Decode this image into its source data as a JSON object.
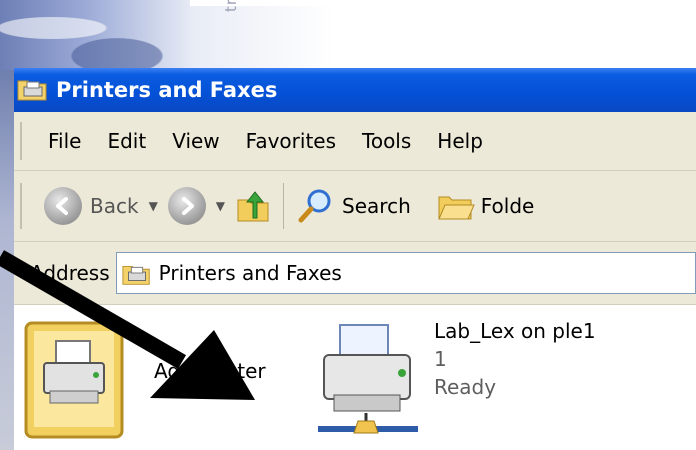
{
  "background": {
    "watermark_text": "trict"
  },
  "window": {
    "title": "Printers and Faxes",
    "title_icon": "printer-folder-icon"
  },
  "menu": {
    "items": [
      "File",
      "Edit",
      "View",
      "Favorites",
      "Tools",
      "Help"
    ]
  },
  "toolbar": {
    "back_label": "Back",
    "search_label": "Search",
    "folders_label": "Folde",
    "icons": [
      "back-icon",
      "forward-icon",
      "up-folder-icon",
      "search-icon",
      "folders-icon"
    ]
  },
  "address": {
    "label": "Address",
    "value": "Printers and Faxes",
    "icon": "printer-folder-icon"
  },
  "items": [
    {
      "name": "Add Printer",
      "icon": "add-printer-icon"
    },
    {
      "name": "Lab_Lex on ple1",
      "documents": "1",
      "status": "Ready",
      "icon": "network-printer-icon"
    }
  ],
  "annotation": {
    "type": "arrow",
    "color": "#000000"
  }
}
